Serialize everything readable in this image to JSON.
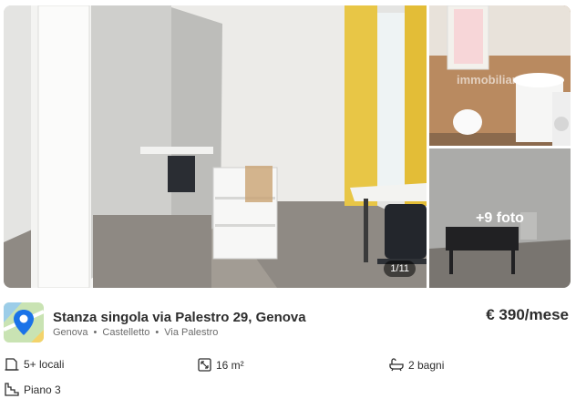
{
  "gallery": {
    "counter": "1/11",
    "more_photos": "+9 foto",
    "watermark": "immobiliare"
  },
  "listing": {
    "title": "Stanza singola via Palestro 29, Genova",
    "location": [
      "Genova",
      "Castelletto",
      "Via Palestro"
    ],
    "price": "€ 390/mese"
  },
  "features": {
    "rooms": "5+ locali",
    "area": "16 m²",
    "bathrooms": "2 bagni",
    "floor": "Piano 3"
  },
  "icons": [
    "map-pin-icon",
    "door-icon",
    "area-icon",
    "bathtub-icon",
    "stairs-icon"
  ],
  "colors": {
    "accent": "#1a73e8",
    "map_green": "#c9e3b3",
    "map_blue": "#9ccde8"
  }
}
